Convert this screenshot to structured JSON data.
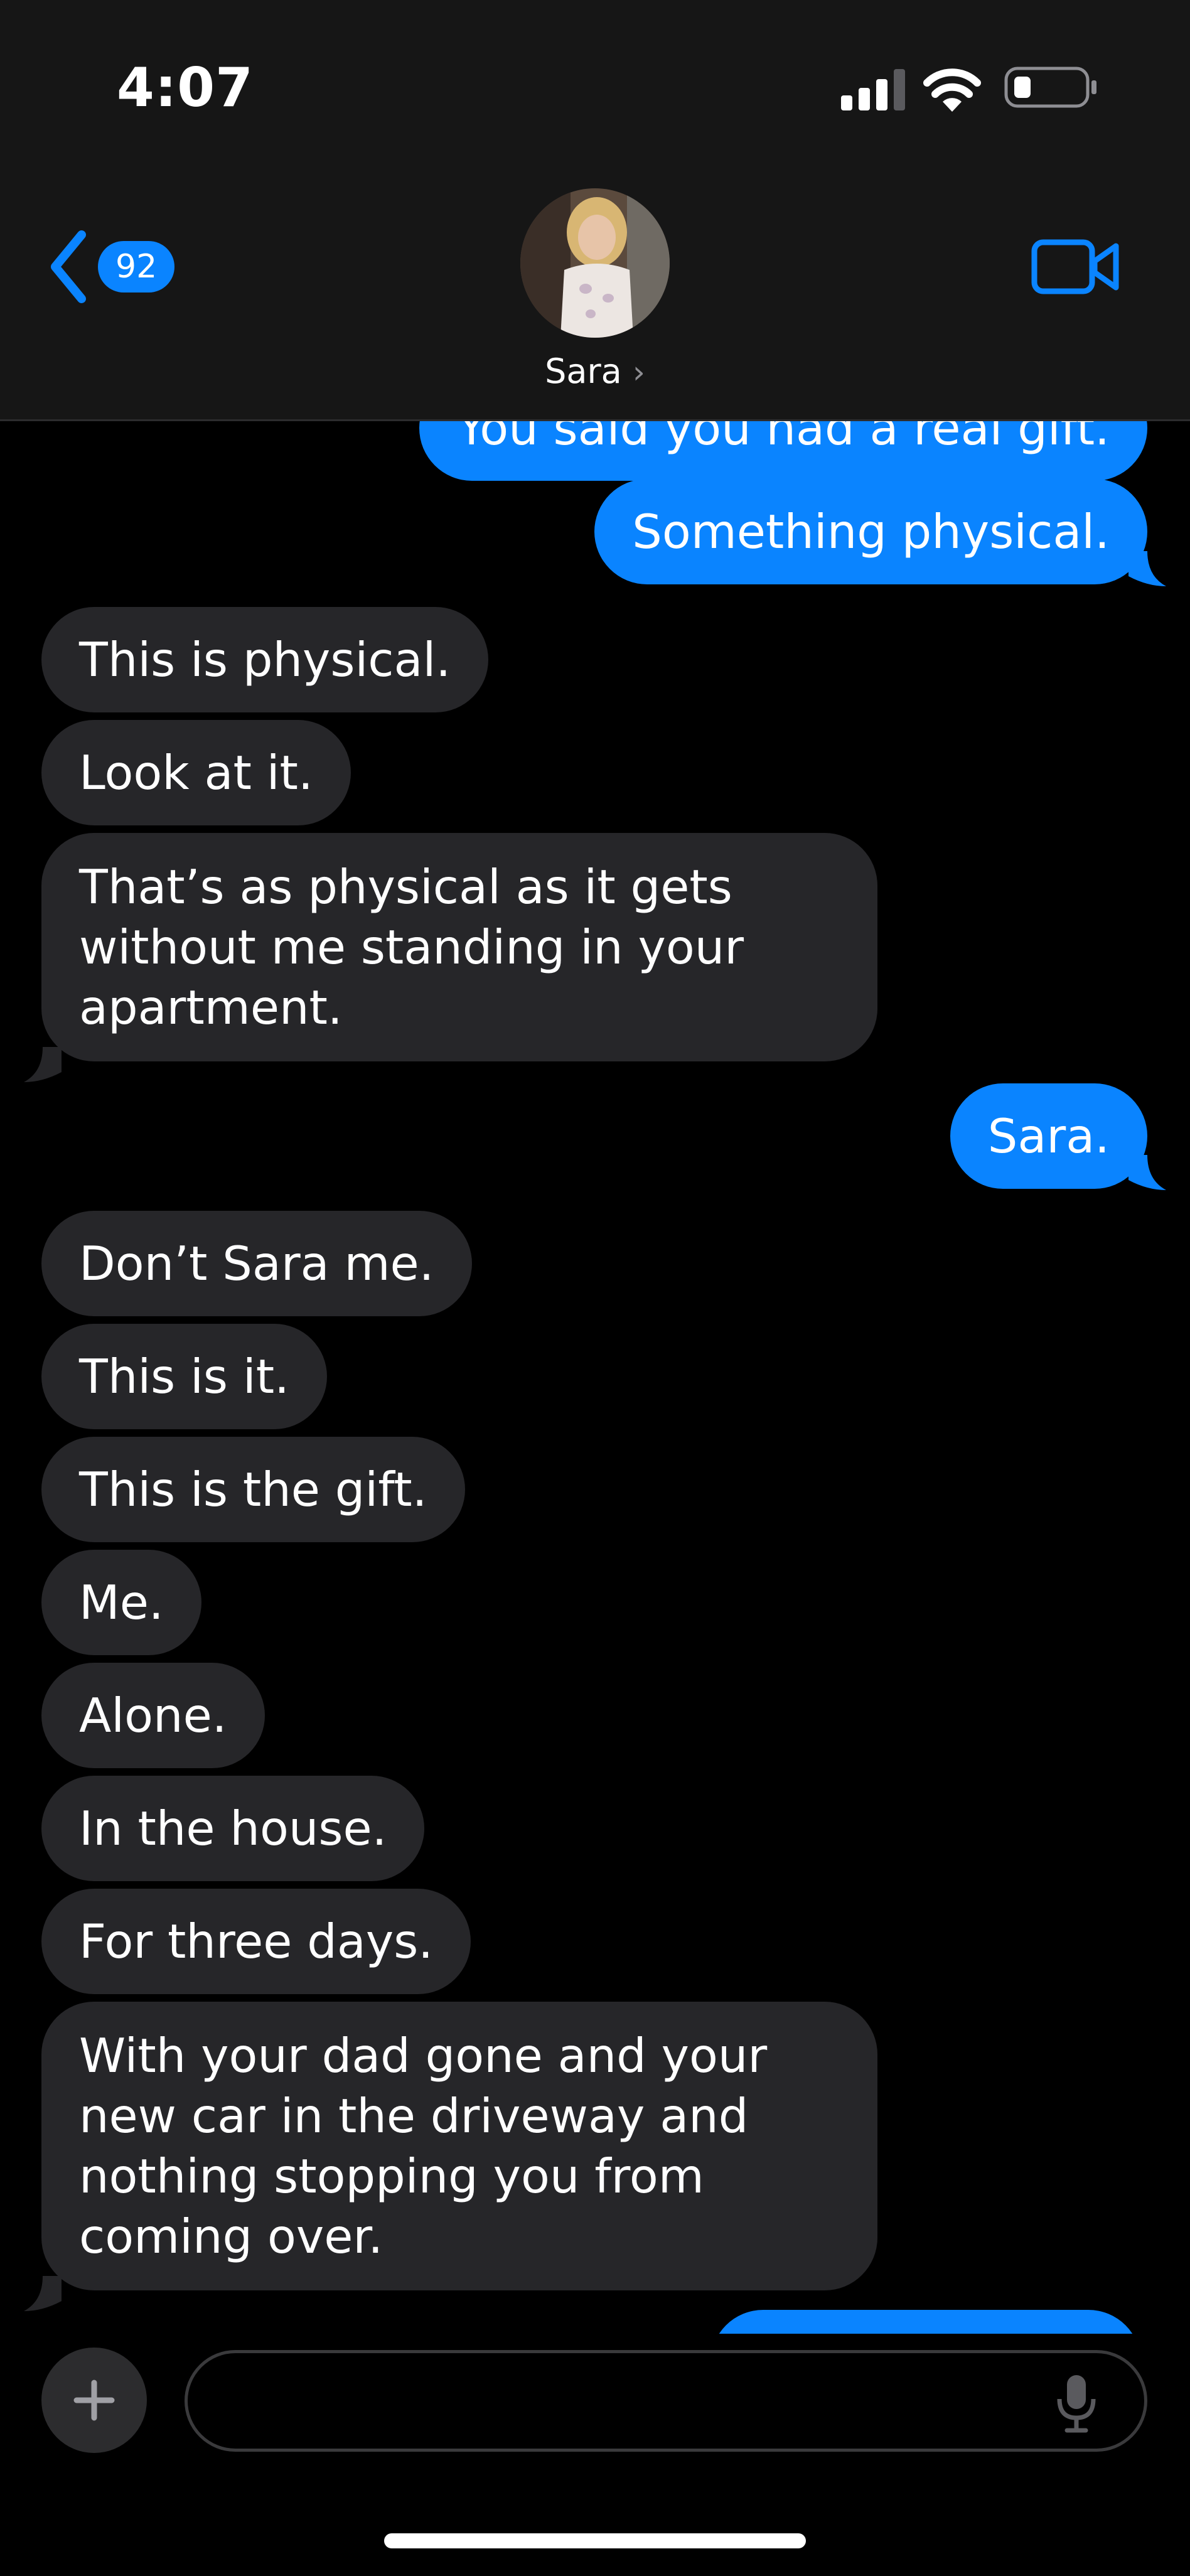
{
  "status_bar": {
    "time": "4:07"
  },
  "header": {
    "back_count": "92",
    "contact_name": "Sara",
    "chevron": "›"
  },
  "messages": [
    {
      "text": "You said you had a real gift.",
      "dir": "out"
    },
    {
      "text": "Something physical.",
      "dir": "out"
    },
    {
      "text": "This is physical.",
      "dir": "in"
    },
    {
      "text": "Look at it.",
      "dir": "in"
    },
    {
      "text": "That’s as physical as it gets\nwithout me standing in your\napartment.",
      "dir": "in"
    },
    {
      "text": "Sara.",
      "dir": "out"
    },
    {
      "text": "Don’t Sara me.",
      "dir": "in"
    },
    {
      "text": "This is it.",
      "dir": "in"
    },
    {
      "text": "This is the gift.",
      "dir": "in"
    },
    {
      "text": "Me.",
      "dir": "in"
    },
    {
      "text": "Alone.",
      "dir": "in"
    },
    {
      "text": "In the house.",
      "dir": "in"
    },
    {
      "text": "For three days.",
      "dir": "in"
    },
    {
      "text": "With your dad gone and your\nnew car in the driveway and\nnothing stopping you from\ncoming over.",
      "dir": "in"
    }
  ],
  "composer": {
    "placeholder": ""
  },
  "colors": {
    "outgoing": "#0a84ff",
    "incoming": "#262629",
    "background": "#000000",
    "header": "#161616"
  },
  "icons": [
    "signal-icon",
    "wifi-icon",
    "battery-icon",
    "back-chevron-icon",
    "video-camera-icon",
    "plus-icon",
    "microphone-icon"
  ]
}
